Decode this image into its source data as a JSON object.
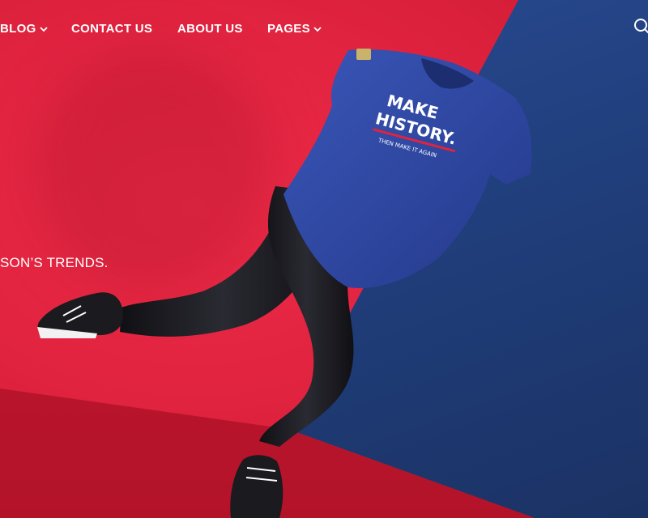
{
  "nav": {
    "items": [
      {
        "label": "BLOG",
        "has_dropdown": true
      },
      {
        "label": "CONTACT US",
        "has_dropdown": false
      },
      {
        "label": "ABOUT US",
        "has_dropdown": false
      },
      {
        "label": "PAGES",
        "has_dropdown": true
      }
    ],
    "search_icon": "search-icon"
  },
  "hero": {
    "tagline": "SON’S TRENDS.",
    "shirt_graphic": {
      "line1": "MAKE",
      "line2": "HISTORY.",
      "line3": "THEN MAKE IT AGAIN"
    }
  },
  "colors": {
    "red": "#e0233f",
    "blue": "#21407f",
    "shirt": "#2f4aa8",
    "leggings": "#1c1c22"
  }
}
